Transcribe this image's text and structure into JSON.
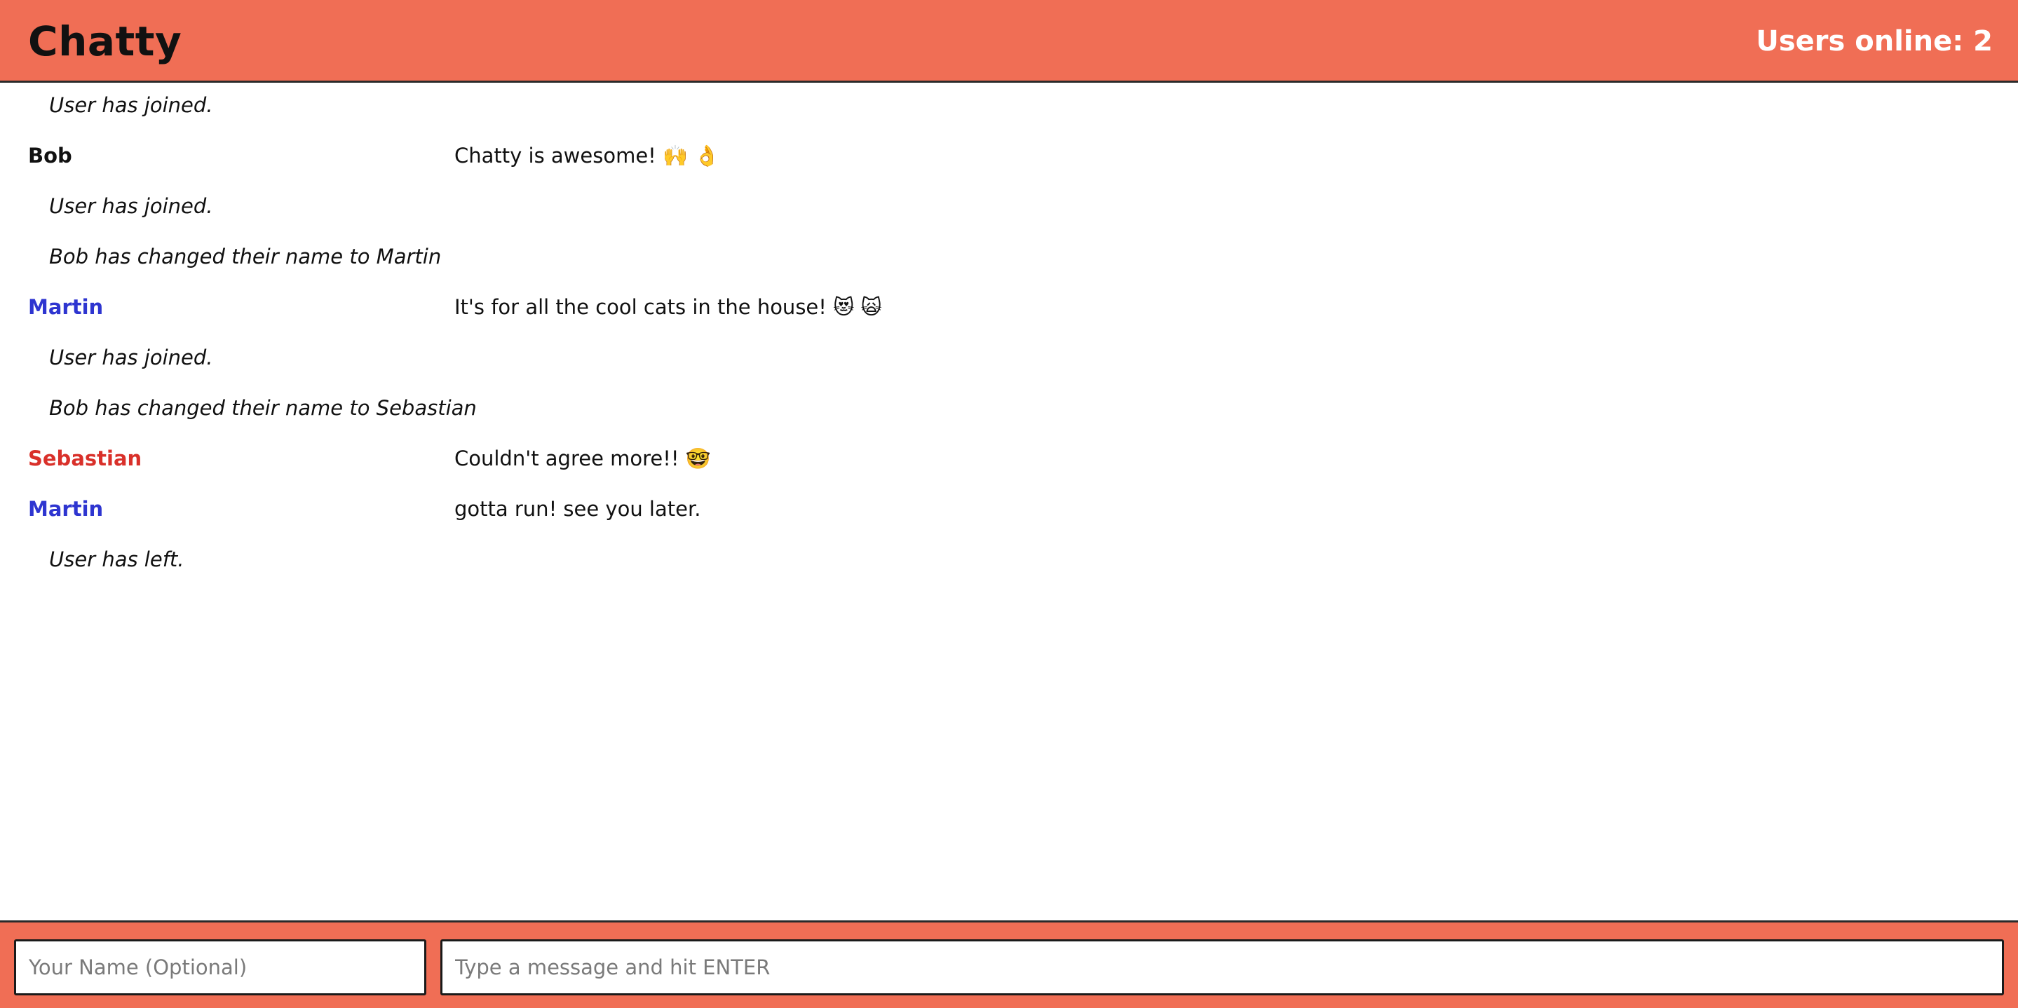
{
  "navbar": {
    "brand": "Chatty",
    "users_online": "Users online: 2",
    "bg_color": "#F06E55"
  },
  "messages": [
    {
      "type": "notification",
      "text": "User has joined."
    },
    {
      "type": "message",
      "username": "Bob",
      "color": "#111111",
      "content": "Chatty is awesome! 🙌 👌"
    },
    {
      "type": "notification",
      "text": "User has joined."
    },
    {
      "type": "notification",
      "text": "Bob has changed their name to Martin"
    },
    {
      "type": "message",
      "username": "Martin",
      "color": "#2E35D0",
      "content": "It's for all the cool cats in the house! 😻 🙀"
    },
    {
      "type": "notification",
      "text": "User has joined."
    },
    {
      "type": "notification",
      "text": "Bob has changed their name to Sebastian"
    },
    {
      "type": "message",
      "username": "Sebastian",
      "color": "#D9302A",
      "content": "Couldn't agree more!! 🤓"
    },
    {
      "type": "message",
      "username": "Martin",
      "color": "#2E35D0",
      "content": "gotta run! see you later."
    },
    {
      "type": "notification",
      "text": "User has left."
    }
  ],
  "chatbar": {
    "name_placeholder": "Your Name (Optional)",
    "name_value": "",
    "message_placeholder": "Type a message and hit ENTER",
    "message_value": ""
  }
}
